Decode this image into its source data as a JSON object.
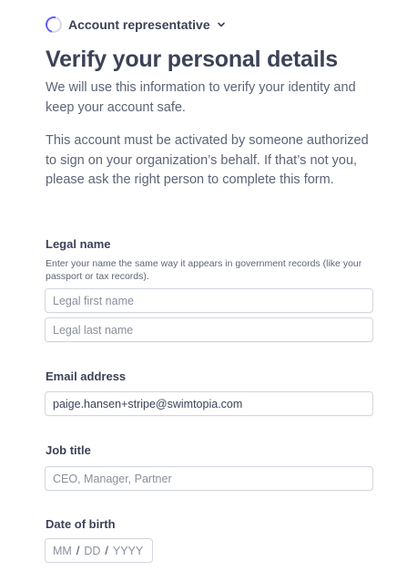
{
  "header": {
    "step_label": "Account representative",
    "step_status": "in-progress"
  },
  "main": {
    "title": "Verify your personal details",
    "intro": "We will use this information to verify your identity and keep your account safe.",
    "notice": "This account must be activated by someone authorized to sign on your organization’s behalf. If that’s not you, please ask the right person to complete this form."
  },
  "legal_name": {
    "label": "Legal name",
    "help": "Enter your name the same way it appears in government records (like your passport or tax records).",
    "first_placeholder": "Legal first name",
    "last_placeholder": "Legal last name"
  },
  "email": {
    "label": "Email address",
    "value": "paige.hansen+stripe@swimtopia.com"
  },
  "job_title": {
    "label": "Job title",
    "placeholder": "CEO, Manager, Partner"
  },
  "dob": {
    "label": "Date of birth",
    "month_placeholder": "MM",
    "day_placeholder": "DD",
    "year_placeholder": "YYYY",
    "separator": "/"
  },
  "colors": {
    "accent": "#635bff",
    "text": "#3c4257",
    "muted": "#5d6476",
    "border": "#d3d6dd"
  }
}
